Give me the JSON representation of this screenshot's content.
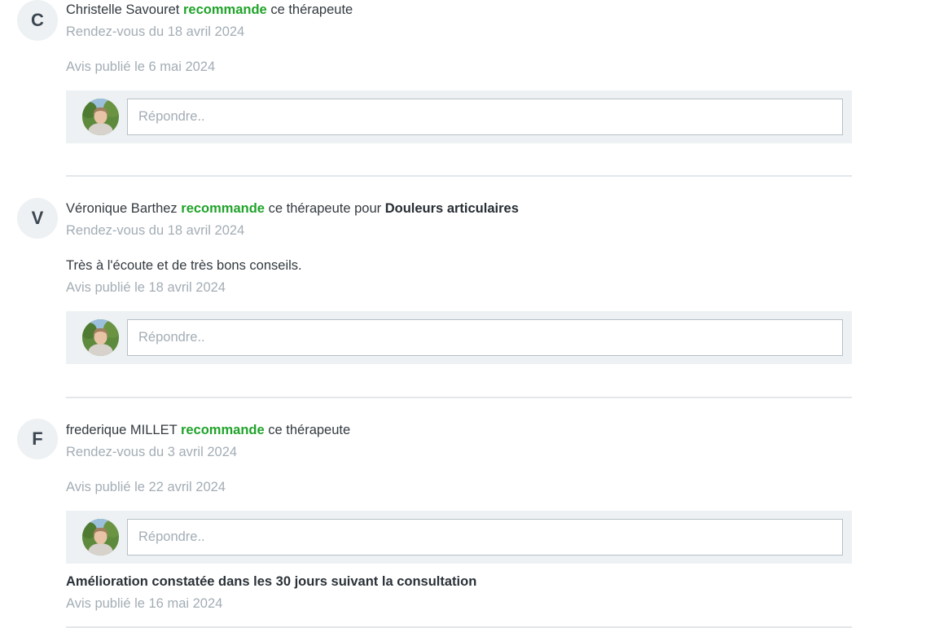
{
  "colors": {
    "recommend_green": "#20a32a",
    "muted_text": "#a3adb5",
    "reply_bg": "#edf1f3",
    "avatar_bg": "#edf1f3"
  },
  "recommend_word": "recommande",
  "reply_placeholder": "Répondre..",
  "reviews": [
    {
      "initial": "C",
      "author": "Christelle Savouret",
      "recommend_label": "recommande",
      "after_text": "ce thérapeute",
      "appointment": "Rendez-vous du 18 avril 2024",
      "published": "Avis publié le 6 mai 2024"
    },
    {
      "initial": "V",
      "author": "Véronique Barthez",
      "recommend_label": "recommande",
      "after_text": "ce thérapeute pour",
      "pathology": "Douleurs articulaires",
      "appointment": "Rendez-vous du 18 avril 2024",
      "comment": "Très à l'écoute et de très bons conseils.",
      "published": "Avis publié le 18 avril 2024"
    },
    {
      "initial": "F",
      "author": "frederique MILLET",
      "recommend_label": "recommande",
      "after_text": "ce thérapeute",
      "appointment": "Rendez-vous du 3 avril 2024",
      "published": "Avis publié le 22 avril 2024",
      "improvement": "Amélioration constatée dans les 30 jours suivant la consultation",
      "improvement_published": "Avis publié le 16 mai 2024"
    }
  ]
}
